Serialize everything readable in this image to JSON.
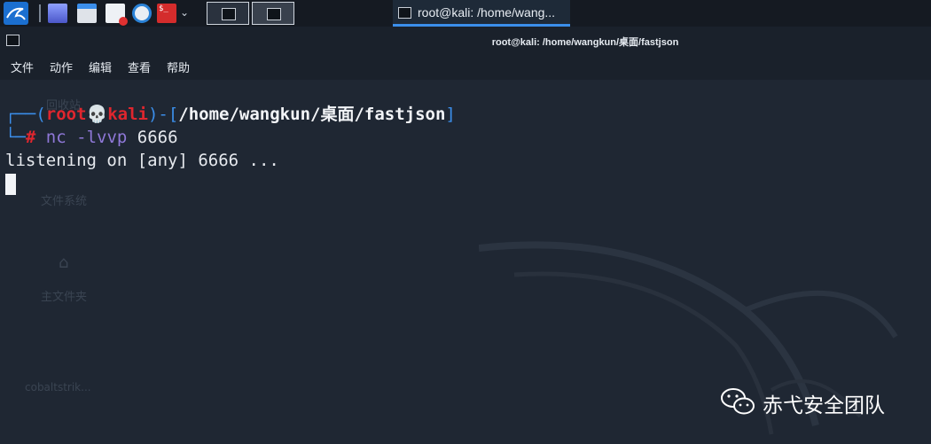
{
  "taskbar": {
    "terminal_icon_text": "$_",
    "active_task_label": "root@kali: /home/wang..."
  },
  "window": {
    "title": "root@kali: /home/wangkun/桌面/fastjson"
  },
  "menu": {
    "items": [
      "文件",
      "动作",
      "编辑",
      "查看",
      "帮助"
    ]
  },
  "terminal": {
    "prompt": {
      "user": "root",
      "skull": "💀",
      "host": "kali",
      "path": "/home/wangkun/桌面/fastjson",
      "symbol": "#"
    },
    "command": {
      "program": "nc",
      "args": "-lvvp",
      "port": "6666"
    },
    "output": "listening on [any] 6666 ..."
  },
  "desktop_background": {
    "faint_labels": [
      "回收站",
      "文件系统",
      "主文件夹",
      "cobaltstrik..."
    ]
  },
  "watermark": {
    "text": "赤弋安全团队",
    "icon": "wechat-icon"
  },
  "colors": {
    "background": "#1f2733",
    "prompt_blue": "#3b8eea",
    "prompt_red": "#e0262e",
    "command_purple": "#8f78d8"
  }
}
